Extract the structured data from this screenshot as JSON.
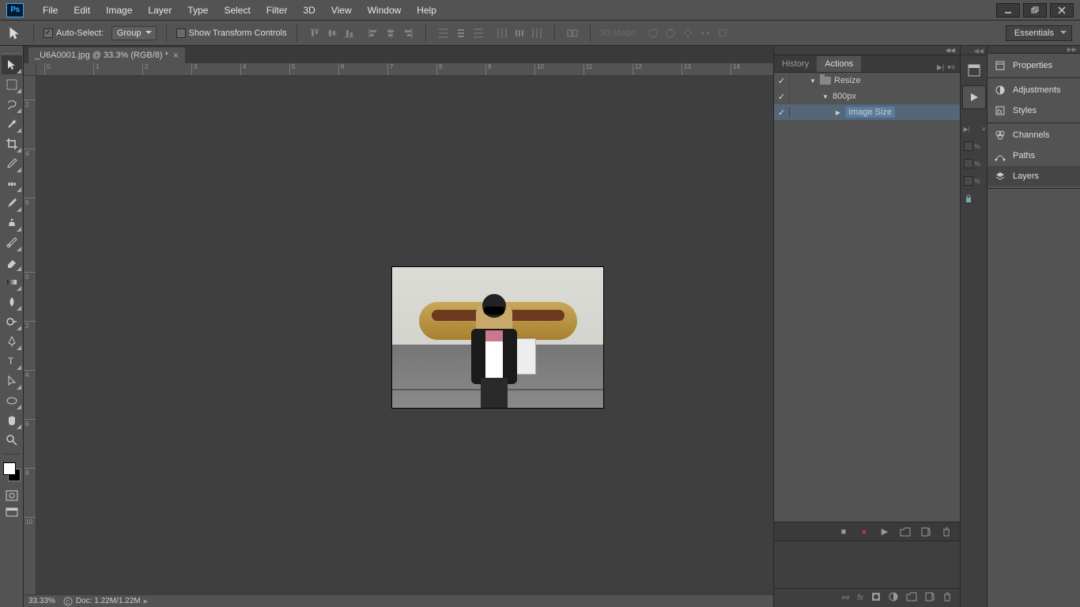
{
  "menu": {
    "items": [
      "File",
      "Edit",
      "Image",
      "Layer",
      "Type",
      "Select",
      "Filter",
      "3D",
      "View",
      "Window",
      "Help"
    ]
  },
  "options": {
    "auto_select": "Auto-Select:",
    "group": "Group",
    "show_transform": "Show Transform Controls",
    "mode_3d": "3D Mode:"
  },
  "workspace_switch": "Essentials",
  "document": {
    "tab_title": "_U6A0001.jpg @ 33.3% (RGB/8) *",
    "zoom": "33.33%",
    "doc_info": "Doc: 1.22M/1.22M"
  },
  "ruler_h": [
    "0",
    "1",
    "2",
    "3",
    "4",
    "5",
    "6",
    "7",
    "8",
    "9",
    "10",
    "11",
    "12",
    "13",
    "14"
  ],
  "ruler_v": [
    "0",
    "2",
    "4",
    "6",
    "4",
    "6",
    "8",
    "10"
  ],
  "panels": {
    "history_tab": "History",
    "actions_tab": "Actions",
    "actions": {
      "set": "Resize",
      "action": "800px",
      "step": "Image Size"
    }
  },
  "right": {
    "properties": "Properties",
    "adjustments": "Adjustments",
    "styles": "Styles",
    "channels": "Channels",
    "paths": "Paths",
    "layers": "Layers"
  }
}
